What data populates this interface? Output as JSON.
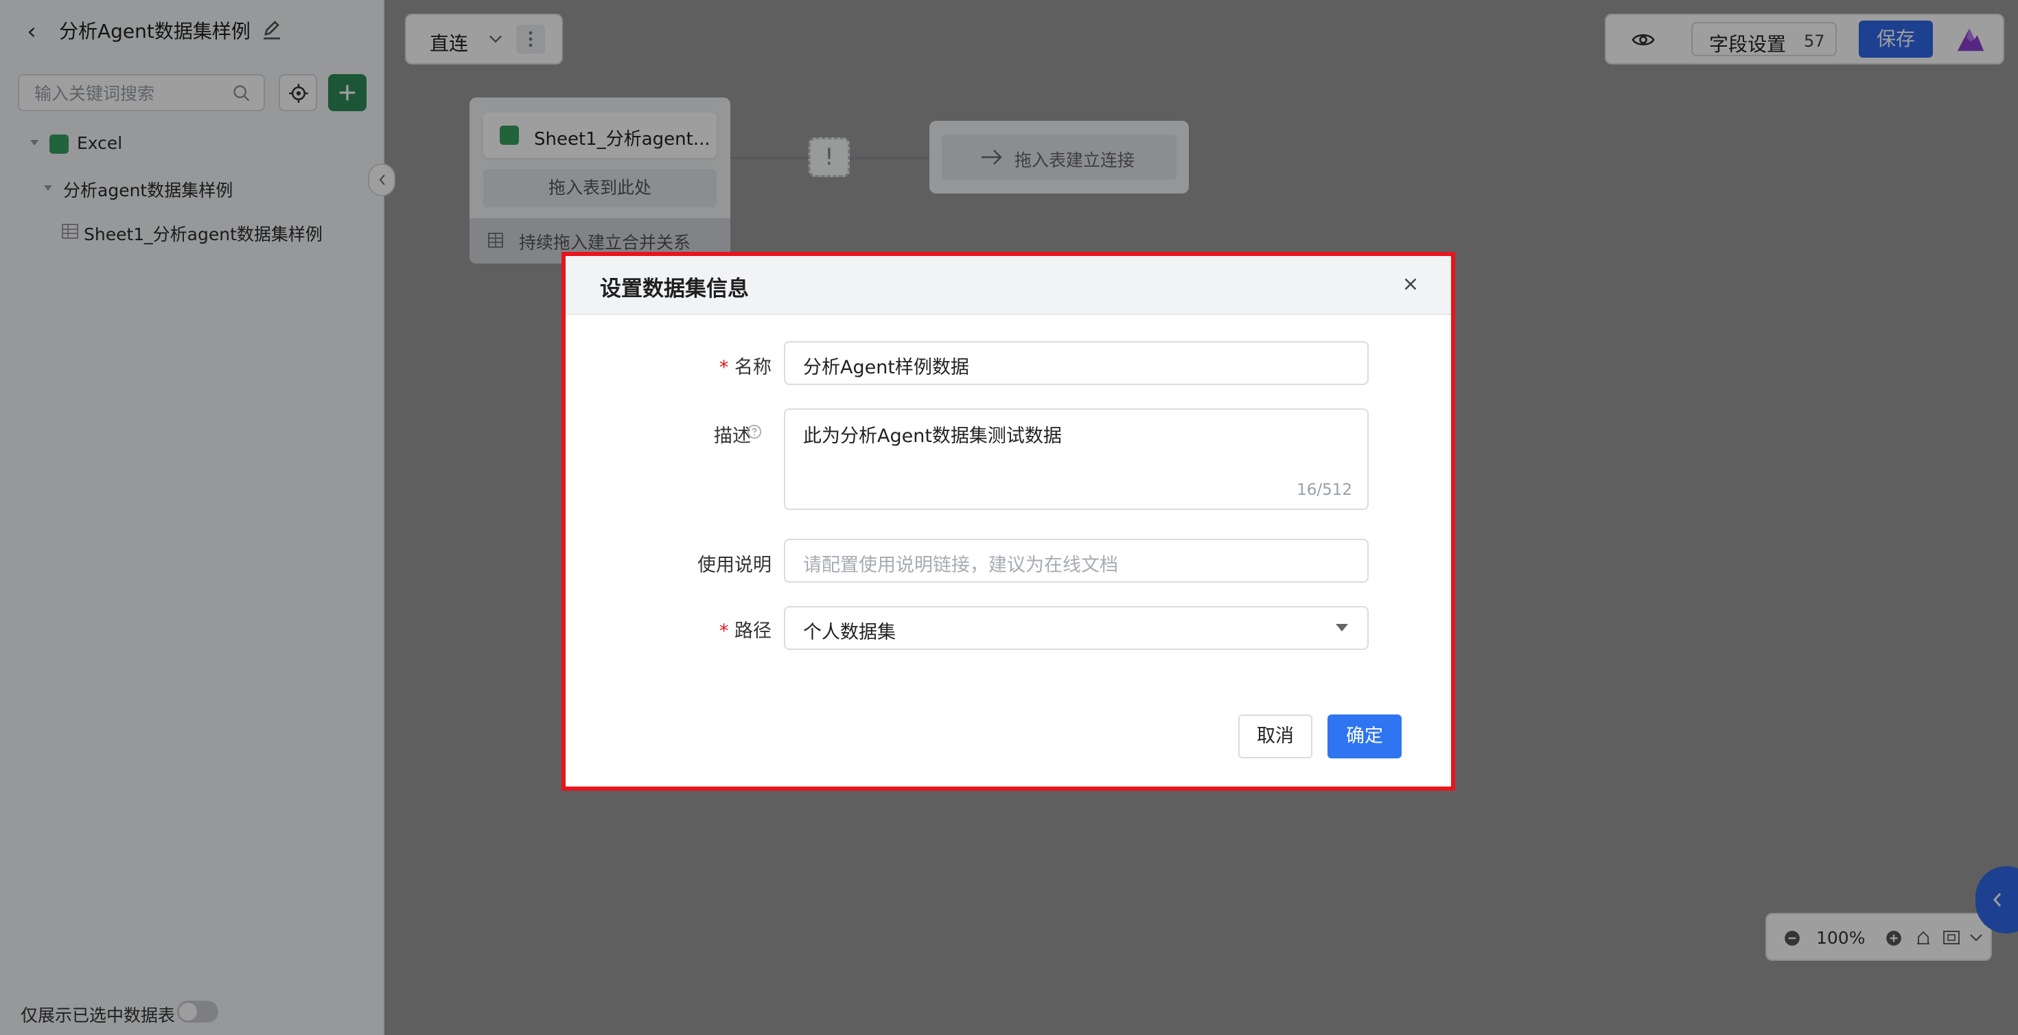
{
  "sidebar": {
    "title": "分析Agent数据集样例",
    "search_placeholder": "输入关键词搜索",
    "tree": {
      "source": "Excel",
      "folder": "分析agent数据集样例",
      "sheet": "Sheet1_分析agent数据集样例"
    },
    "bottom_toggle_label": "仅展示已选中数据表"
  },
  "canvas": {
    "mode_label": "直连",
    "node_title": "Sheet1_分析agent...",
    "node_drop_label": "拖入表到此处",
    "node_merge_label": "持续拖入建立合并关系",
    "connect_label": "拖入表建立连接",
    "warning_symbol": "!"
  },
  "toolbar": {
    "field_settings_label": "字段设置",
    "field_count": "57",
    "save_label": "保存"
  },
  "zoom": {
    "level": "100%"
  },
  "modal": {
    "title": "设置数据集信息",
    "name_label": "名称",
    "name_value": "分析Agent样例数据",
    "desc_label": "描述",
    "desc_value": "此为分析Agent数据集测试数据",
    "desc_counter": "16/512",
    "usage_label": "使用说明",
    "usage_placeholder": "请配置使用说明链接，建议为在线文档",
    "path_label": "路径",
    "path_value": "个人数据集",
    "required_mark": "*",
    "cancel_label": "取消",
    "ok_label": "确定"
  },
  "colors": {
    "primary": "#2f68e8",
    "add_button": "#2e8b57",
    "highlight_border": "#e8141b"
  }
}
